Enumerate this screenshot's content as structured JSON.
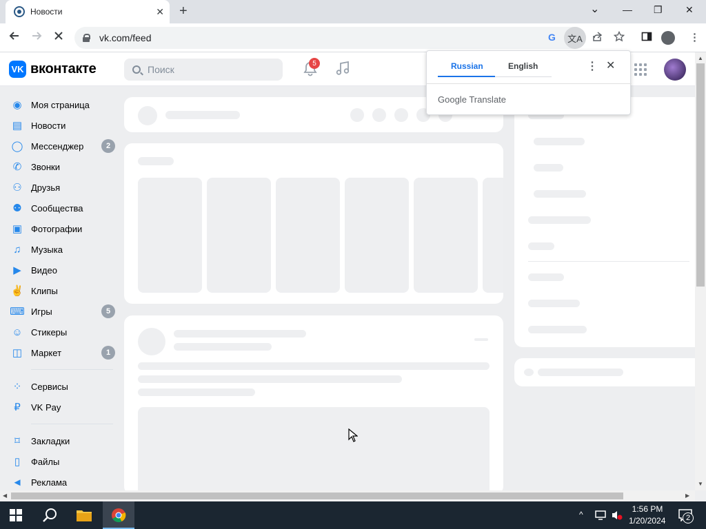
{
  "browser": {
    "tab_title": "Новости",
    "tab_close": "✕",
    "new_tab": "+",
    "window_controls": {
      "minimize": "—",
      "restore": "❐",
      "close": "✕",
      "tabsearch": "⌄"
    },
    "url": "vk.com/feed",
    "google_icon": "G",
    "translate_icon": "文A"
  },
  "translate_popup": {
    "tab_source": "Russian",
    "tab_target": "English",
    "menu": "⋮",
    "close": "✕",
    "brand": "Google",
    "brand_suffix": "Translate"
  },
  "vk": {
    "logo_mark": "VK",
    "logo_text": "вконтакте",
    "search_placeholder": "Поиск",
    "notifications_count": "5"
  },
  "sidebar": {
    "items": [
      {
        "label": "Моя страница",
        "icon": "user-circle-icon",
        "badge": ""
      },
      {
        "label": "Новости",
        "icon": "news-icon",
        "badge": ""
      },
      {
        "label": "Мессенджер",
        "icon": "message-icon",
        "badge": "2"
      },
      {
        "label": "Звонки",
        "icon": "phone-icon",
        "badge": ""
      },
      {
        "label": "Друзья",
        "icon": "friends-icon",
        "badge": ""
      },
      {
        "label": "Сообщества",
        "icon": "communities-icon",
        "badge": ""
      },
      {
        "label": "Фотографии",
        "icon": "camera-icon",
        "badge": ""
      },
      {
        "label": "Музыка",
        "icon": "music-icon",
        "badge": ""
      },
      {
        "label": "Видео",
        "icon": "video-icon",
        "badge": ""
      },
      {
        "label": "Клипы",
        "icon": "clips-icon",
        "badge": ""
      },
      {
        "label": "Игры",
        "icon": "gamepad-icon",
        "badge": "5"
      },
      {
        "label": "Стикеры",
        "icon": "smile-icon",
        "badge": ""
      },
      {
        "label": "Маркет",
        "icon": "bag-icon",
        "badge": "1"
      }
    ],
    "items2": [
      {
        "label": "Сервисы",
        "icon": "services-icon"
      },
      {
        "label": "VK Pay",
        "icon": "vkpay-icon"
      }
    ],
    "items3": [
      {
        "label": "Закладки",
        "icon": "bookmark-icon"
      },
      {
        "label": "Файлы",
        "icon": "file-icon"
      },
      {
        "label": "Реклама",
        "icon": "megaphone-icon"
      }
    ]
  },
  "taskbar": {
    "time": "1:56 PM",
    "date": "1/20/2024",
    "notification_count": "2"
  },
  "colors": {
    "vk_blue": "#0077ff",
    "accent": "#2688eb",
    "badge_red": "#e64646",
    "translate_blue": "#1a73e8"
  }
}
